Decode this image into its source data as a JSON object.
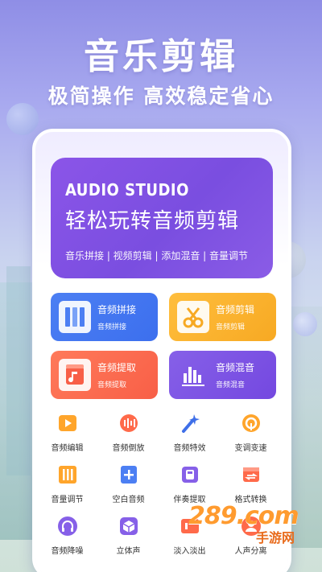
{
  "banner": {
    "title": "音乐剪辑",
    "subtitle": "极简操作 高效稳定省心"
  },
  "hero": {
    "brand": "AUDIO STUDIO",
    "slogan": "轻松玩转音频剪辑",
    "tags": "音乐拼接 | 视频剪辑 | 添加混音 | 音量调节"
  },
  "big_cards": [
    {
      "title": "音频拼接",
      "sub": "音频拼接",
      "icon": "audio-merge-icon",
      "color": "#4c7ff3"
    },
    {
      "title": "音频剪辑",
      "sub": "音频剪辑",
      "icon": "scissors-icon",
      "color": "#ffbe3d"
    },
    {
      "title": "音频提取",
      "sub": "音频提取",
      "icon": "audio-extract-icon",
      "color": "#ff7a5a"
    },
    {
      "title": "音频混音",
      "sub": "音频混音",
      "icon": "mixer-icon",
      "color": "#8660e8"
    }
  ],
  "tools": [
    {
      "label": "音频编辑",
      "icon": "play-edit-icon",
      "color": "#ffa52b"
    },
    {
      "label": "音频倒放",
      "icon": "reverse-icon",
      "color": "#ff6a4a"
    },
    {
      "label": "音频特效",
      "icon": "magic-wand-icon",
      "color": "#3f6fe8"
    },
    {
      "label": "变调变速",
      "icon": "pitch-icon",
      "color": "#ffa52b"
    },
    {
      "label": "音量调节",
      "icon": "volume-sliders-icon",
      "color": "#ffa52b"
    },
    {
      "label": "空白音频",
      "icon": "plus-file-icon",
      "color": "#4c7ff3"
    },
    {
      "label": "伴奏提取",
      "icon": "accompaniment-icon",
      "color": "#8660e8"
    },
    {
      "label": "格式转换",
      "icon": "convert-icon",
      "color": "#ff6a4a"
    },
    {
      "label": "音频降噪",
      "icon": "headphones-icon",
      "color": "#8660e8"
    },
    {
      "label": "立体声",
      "icon": "cube-icon",
      "color": "#8660e8"
    },
    {
      "label": "淡入淡出",
      "icon": "fade-icon",
      "color": "#ff6a4a"
    },
    {
      "label": "人声分离",
      "icon": "voice-split-icon",
      "color": "#ff6a4a"
    }
  ],
  "watermark": {
    "main": "289.com",
    "sub": "手游网"
  }
}
